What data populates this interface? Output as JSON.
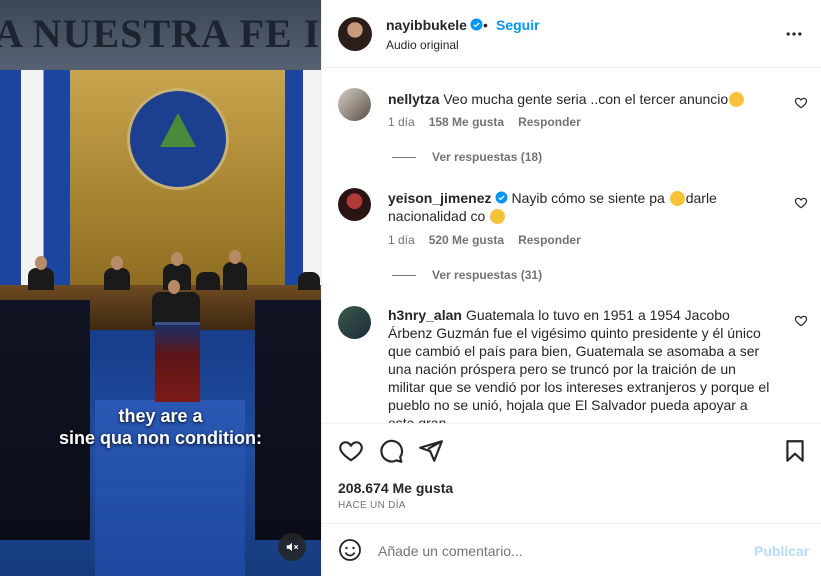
{
  "media": {
    "subtitle_line1": "they are a",
    "subtitle_line2": "sine qua non condition:",
    "banner_text": "A NUESTRA FE I",
    "mute_icon": "speaker-muted-icon"
  },
  "header": {
    "username": "nayibbukele",
    "verified": true,
    "separator": "•",
    "follow_label": "Seguir",
    "audio_label": "Audio original",
    "more_icon": "more-horizontal-icon"
  },
  "comments": [
    {
      "username": "nellytza",
      "text": "Veo mucha gente seria ..con el tercer anuncio",
      "emoji": "thinking-face",
      "time": "1 día",
      "likes": "158 Me gusta",
      "reply_label": "Responder",
      "view_replies": "Ver respuestas (18)"
    },
    {
      "username": "yeison_jimenez",
      "verified": true,
      "text_part1": "Nayib cómo se siente pa",
      "emoji1": "sad-face",
      "text_part2": "darle nacionalidad co",
      "emoji2": "laughing-face",
      "time": "1 día",
      "likes": "520 Me gusta",
      "reply_label": "Responder",
      "view_replies": "Ver respuestas (31)"
    },
    {
      "username": "h3nry_alan",
      "text": "Guatemala lo tuvo en 1951 a 1954 Jacobo Árbenz Guzmán fue el vigésimo quinto presidente y él único que cambió el país para bien, Guatemala se asomaba a ser una nación próspera pero se truncó por la traición de un militar que se vendió por los intereses extranjeros y porque el pueblo no se unió, hojala que El Salvador pueda apoyar a este gran"
    }
  ],
  "actions": {
    "like_icon": "heart-icon",
    "comment_icon": "comment-bubble-icon",
    "share_icon": "paper-plane-icon",
    "save_icon": "bookmark-icon",
    "likes_count": "208.674 Me gusta",
    "posted_ago": "HACE UN DÍA"
  },
  "composer": {
    "emoji_icon": "smiley-icon",
    "placeholder": "Añade un comentario...",
    "publish_label": "Publicar"
  },
  "colors": {
    "link_blue": "#0095f6",
    "publish_disabled": "#b3dbff",
    "muted_text": "#737373",
    "text": "#262626",
    "border": "#efefef"
  }
}
